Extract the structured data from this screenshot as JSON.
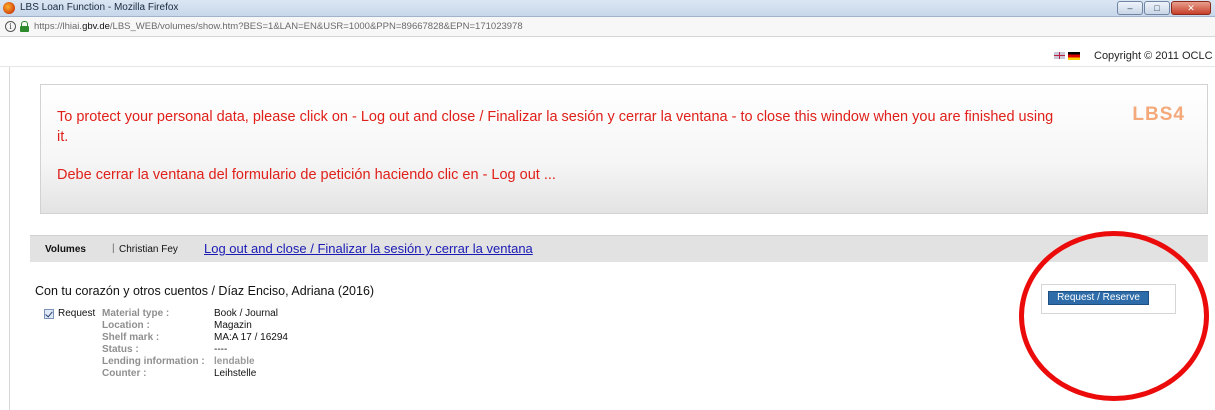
{
  "window": {
    "title": "LBS Loan Function - Mozilla Firefox",
    "buttons": {
      "minimize": "–",
      "maximize": "□",
      "close": "✕"
    }
  },
  "browser": {
    "url_prefix": "https://lhiai.",
    "url_domain": "gbv.de",
    "url_path": "/LBS_WEB/volumes/show.htm?BES=1&LAN=EN&USR=1000&PPN=89667828&EPN=171023978"
  },
  "header": {
    "copyright": "Copyright © 2011 OCLC",
    "flags": [
      "uk-flag",
      "de-flag"
    ]
  },
  "notice": {
    "message_en": "To protect your personal data, please click on - Log out and close / Finalizar la sesión y cerrar la ventana - to close this window when you are finished using it.",
    "message_es": "Debe cerrar la ventana del formulario de petición haciendo clic en - Log out ...",
    "logo": "LBS4",
    "text_color": "#e0201a",
    "logo_color": "#f4a97a"
  },
  "nav": {
    "volumes": "Volumes",
    "separator": "|",
    "user": "Christian Fey",
    "logout_link": "Log out and close / Finalizar la sesión y cerrar la ventana"
  },
  "book": {
    "title": "Con tu corazón y otros cuentos / Díaz Enciso, Adriana (2016)",
    "request_label": "Request",
    "request_checked": true,
    "fields": [
      {
        "label": "Material type :",
        "value": "Book / Journal"
      },
      {
        "label": "Location :",
        "value": "Magazin"
      },
      {
        "label": "Shelf mark :",
        "value": "MA:A 17 / 16294"
      },
      {
        "label": "Status :",
        "value": "----"
      },
      {
        "label": "Lending information :",
        "value": "lendable"
      },
      {
        "label": "Counter :",
        "value": "Leihstelle"
      }
    ]
  },
  "actions": {
    "request_reserve": "Request / Reserve",
    "button_color": "#2d6ca8",
    "highlight_color": "#ec0b0b"
  }
}
